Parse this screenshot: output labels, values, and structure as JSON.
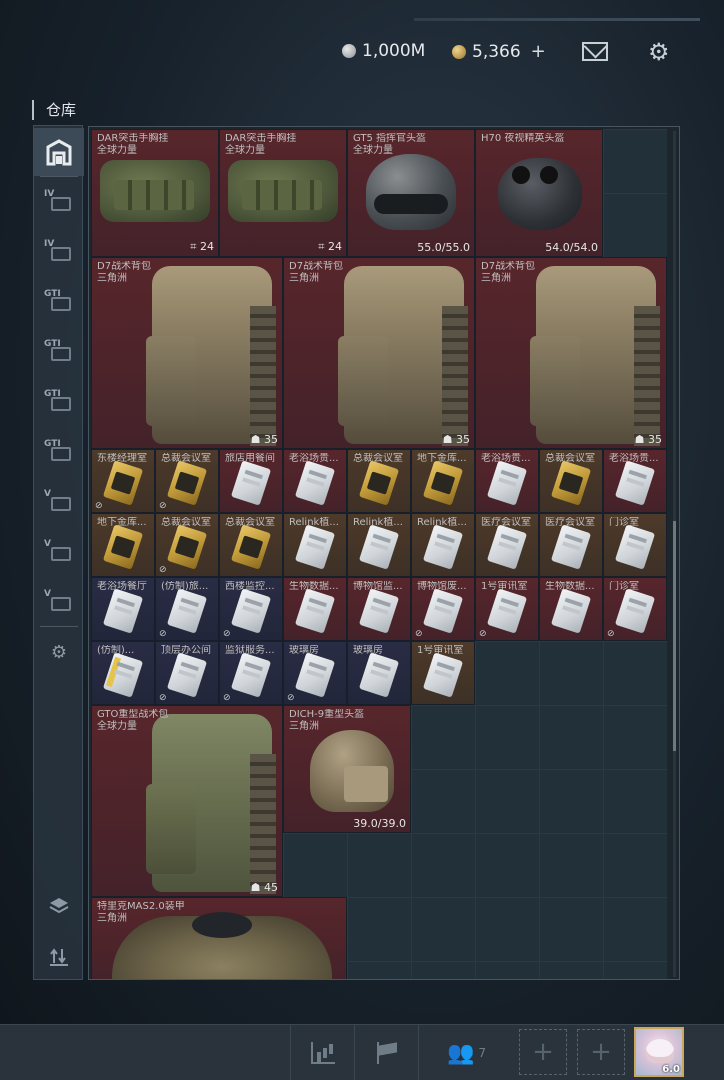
{
  "currency": {
    "silver": "1,000M",
    "gold": "5,366",
    "gold_add": "+"
  },
  "warehouse": {
    "title": "仓库"
  },
  "sidebar": {
    "tabs": [
      {
        "label": "IV"
      },
      {
        "label": "IV"
      },
      {
        "label": "GTI"
      },
      {
        "label": "GTI"
      },
      {
        "label": "GTI"
      },
      {
        "label": "GTI"
      },
      {
        "label": "V"
      },
      {
        "label": "V"
      },
      {
        "label": "V"
      }
    ]
  },
  "items": {
    "vest1": {
      "name": "DAR突击手胸挂",
      "sub": "全球力量",
      "qty": "24"
    },
    "vest2": {
      "name": "DAR突击手胸挂",
      "sub": "全球力量",
      "qty": "24"
    },
    "helmet_gt5": {
      "name": "GT5 指挥官头盔",
      "sub": "全球力量",
      "qty": "55.0/55.0"
    },
    "helmet_h70": {
      "name": "H70 夜视精英头盔",
      "qty": "54.0/54.0"
    },
    "pack1": {
      "name": "D7战术背包",
      "sub": "三角洲",
      "qty": "35"
    },
    "pack2": {
      "name": "D7战术背包",
      "sub": "三角洲",
      "qty": "35"
    },
    "pack3": {
      "name": "D7战术背包",
      "sub": "三角洲",
      "qty": "35"
    },
    "pack_gto": {
      "name": "GTO重型战术包",
      "sub": "全球力量",
      "qty": "45"
    },
    "helmet_dich": {
      "name": "DICH-9重型头盔",
      "sub": "三角洲",
      "qty": "39.0/39.0"
    },
    "armor_mas": {
      "name": "特里克MAS2.0装甲",
      "sub": "三角洲"
    }
  },
  "cards": [
    {
      "name": "东楼经理室",
      "style": "gold",
      "card": "g",
      "lock": true
    },
    {
      "name": "总裁会议室",
      "style": "gold",
      "card": "g",
      "lock": true
    },
    {
      "name": "旅店用餐间",
      "style": "red",
      "card": "w",
      "lock": false
    },
    {
      "name": "老浴场贵...",
      "style": "red",
      "card": "w",
      "lock": false
    },
    {
      "name": "总裁会议室",
      "style": "gold",
      "card": "g",
      "lock": false
    },
    {
      "name": "地下金库...",
      "style": "gold",
      "card": "g",
      "lock": false
    },
    {
      "name": "老浴场贵...",
      "style": "red",
      "card": "w",
      "lock": false
    },
    {
      "name": "总裁会议室",
      "style": "gold",
      "card": "g",
      "lock": false
    },
    {
      "name": "老浴场贵...",
      "style": "red",
      "card": "w",
      "lock": false
    },
    {
      "name": "地下金库...",
      "style": "gold",
      "card": "g",
      "lock": false
    },
    {
      "name": "总裁会议室",
      "style": "gold",
      "card": "g",
      "lock": true
    },
    {
      "name": "总裁会议室",
      "style": "gold",
      "card": "g",
      "lock": false
    },
    {
      "name": "Relink植...",
      "style": "gold",
      "card": "w",
      "lock": false
    },
    {
      "name": "Relink植...",
      "style": "gold",
      "card": "w",
      "lock": false
    },
    {
      "name": "Relink植...",
      "style": "gold",
      "card": "w",
      "lock": false
    },
    {
      "name": "医疗会议室",
      "style": "gold",
      "card": "w",
      "lock": false
    },
    {
      "name": "医疗会议室",
      "style": "gold",
      "card": "w",
      "lock": false
    },
    {
      "name": "门诊室",
      "style": "gold",
      "card": "w",
      "lock": false
    },
    {
      "name": "老浴场餐厅",
      "style": "navy",
      "card": "w",
      "lock": false
    },
    {
      "name": "(仿制)旅...",
      "style": "navy",
      "card": "w",
      "lock": true
    },
    {
      "name": "西楼监控...",
      "style": "navy",
      "card": "w",
      "lock": true
    },
    {
      "name": "生物数据...",
      "style": "red",
      "card": "w",
      "lock": false
    },
    {
      "name": "博物馆监...",
      "style": "red",
      "card": "w",
      "lock": false
    },
    {
      "name": "博物馆废...",
      "style": "red",
      "card": "w",
      "lock": true
    },
    {
      "name": "1号审讯室",
      "style": "red",
      "card": "w",
      "lock": true
    },
    {
      "name": "生物数据...",
      "style": "red",
      "card": "w",
      "lock": false
    },
    {
      "name": "门诊室",
      "style": "red",
      "card": "w",
      "lock": true
    },
    {
      "name": "(仿制)...",
      "style": "navy",
      "card": "w y",
      "lock": false
    },
    {
      "name": "顶层办公间",
      "style": "navy",
      "card": "w",
      "lock": true
    },
    {
      "name": "监狱服务...",
      "style": "navy",
      "card": "w",
      "lock": true
    },
    {
      "name": "玻璃房",
      "style": "navy",
      "card": "w",
      "lock": true
    },
    {
      "name": "玻璃房",
      "style": "navy",
      "card": "w",
      "lock": false
    },
    {
      "name": "1号审讯室",
      "style": "gold",
      "card": "w",
      "lock": false
    }
  ],
  "bottom": {
    "friends_count": "7",
    "add_label": "+",
    "avatar_badge": "6.0"
  },
  "icons": {
    "mail": "mail-icon",
    "settings": "gear-icon",
    "warehouse_home": "warehouse-icon",
    "layers": "layers-icon",
    "sort": "sort-icon",
    "stats": "stats-icon",
    "flag": "flag-icon",
    "friends": "friends-icon"
  }
}
